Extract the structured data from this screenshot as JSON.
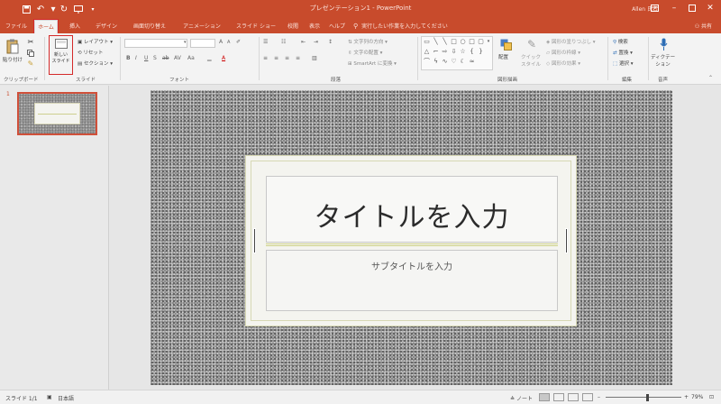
{
  "titlebar": {
    "doc_title": "プレゼンテーション1 - PowerPoint",
    "user": "Allen 氏名",
    "qat_icons": [
      "save-icon",
      "undo-icon",
      "redo-icon",
      "start-slideshow-icon",
      "qat-customize-icon"
    ]
  },
  "tabs": [
    "ファイル",
    "ホーム",
    "挿入",
    "デザイン",
    "画面切り替え",
    "アニメーション",
    "スライド ショー",
    "校閲",
    "表示",
    "ヘルプ"
  ],
  "active_tab": "ホーム",
  "tell_me": "実行したい作業を入力してください",
  "share": "共有",
  "ribbon": {
    "clipboard": {
      "paste": "貼り付け",
      "label": "クリップボード"
    },
    "slides": {
      "new_slide": "新しい\nスライド",
      "layout": "レイアウト",
      "reset": "リセット",
      "section": "セクション",
      "label": "スライド"
    },
    "font": {
      "label": "フォント"
    },
    "paragraph": {
      "text_direction": "文字列の方向",
      "align_text": "文字の配置",
      "smartart": "SmartArt に変換",
      "label": "段落"
    },
    "drawing": {
      "arrange": "配置",
      "quick_styles": "クイック\nスタイル",
      "fill": "図形の塗りつぶし",
      "outline": "図形の枠線",
      "effects": "図形の効果",
      "label": "図形描画"
    },
    "editing": {
      "find": "検索",
      "replace": "置換",
      "select": "選択",
      "label": "編集"
    },
    "voice": {
      "dictate": "ディクテー\nション",
      "label": "音声"
    }
  },
  "thumbnail": {
    "number": "1"
  },
  "slide": {
    "title": "タイトルを入力",
    "subtitle": "サブタイトルを入力"
  },
  "statusbar": {
    "slide_count": "スライド 1/1",
    "language": "日本語",
    "notes": "ノート",
    "zoom": "79%",
    "zoom_level": 0.55
  },
  "colors": {
    "accent": "#c84b2c",
    "selection": "#d42a2a"
  }
}
